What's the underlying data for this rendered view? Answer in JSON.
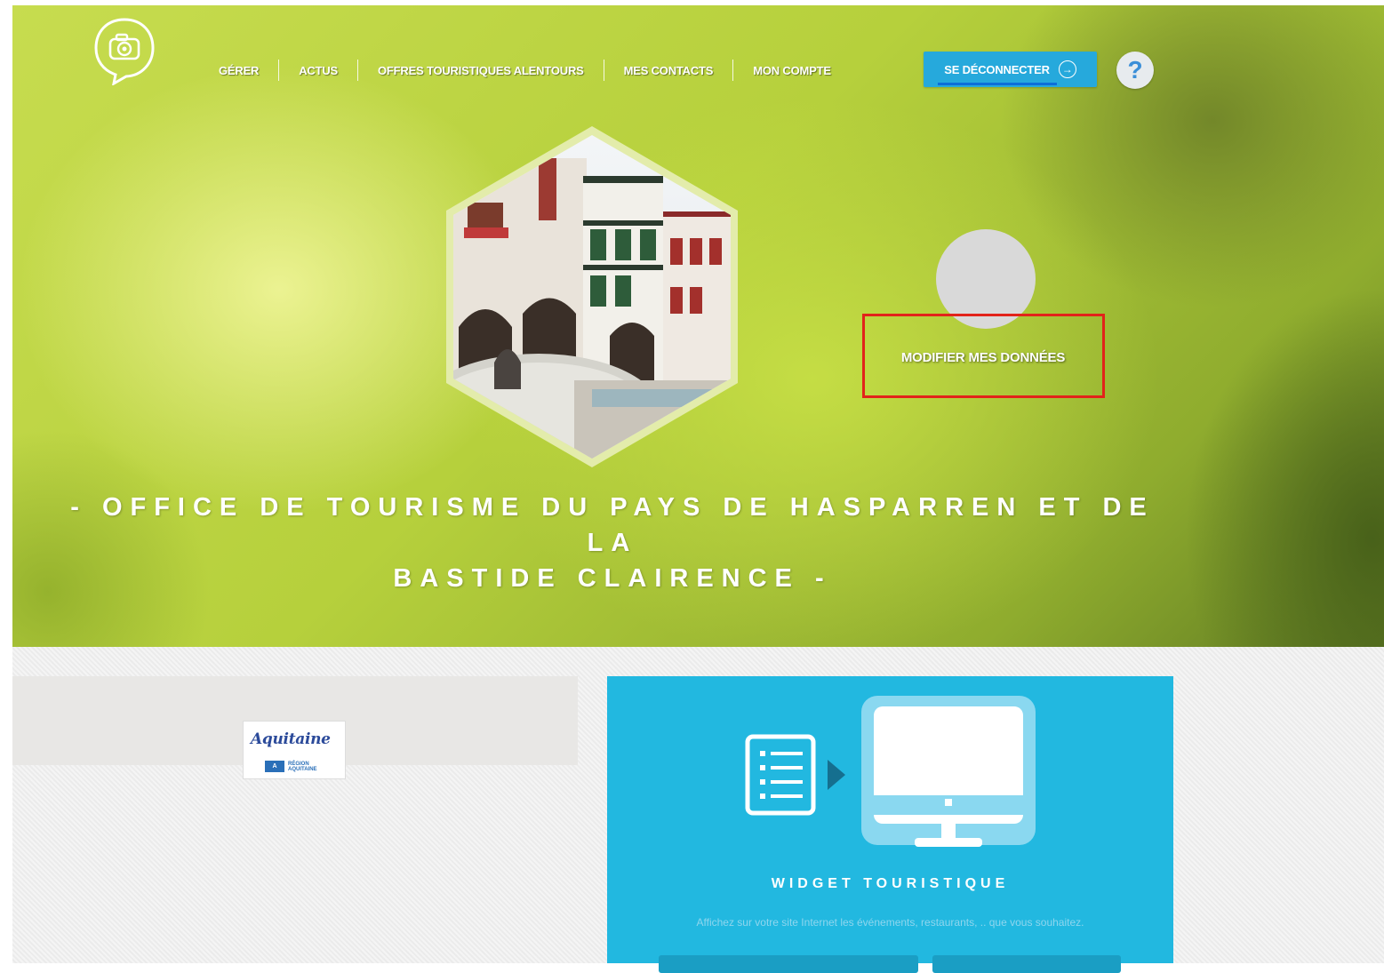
{
  "nav": {
    "items": [
      {
        "label": "GÉRER"
      },
      {
        "label": "ACTUS"
      },
      {
        "label": "OFFRES TOURISTIQUES ALENTOURS"
      },
      {
        "label": "MES CONTACTS"
      },
      {
        "label": "MON COMPTE"
      }
    ],
    "logout_label": "SE DÉCONNECTER",
    "help_label": "?"
  },
  "hero": {
    "edit_link": "MODIFIER MES DONNÉES",
    "title_line1": "- OFFICE DE TOURISME DU PAYS DE HASPARREN ET DE LA",
    "title_line2": "BASTIDE CLAIRENCE -"
  },
  "partners": {
    "logo_brand": "Aquitaine",
    "logo_sub_line1": "RÉGION",
    "logo_sub_line2": "AQUITAINE"
  },
  "widget": {
    "title": "WIDGET TOURISTIQUE",
    "description": "Affichez sur votre site Internet les événements, restaurants, .. que vous souhaitez."
  },
  "colors": {
    "accent_blue": "#26a9dc",
    "widget_blue": "#22b8e0",
    "highlight_red": "#e2231a"
  },
  "icons": [
    "camera-chat-logo-icon",
    "arrow-right-circle-icon",
    "question-icon",
    "document-list-icon",
    "play-arrow-icon",
    "monitor-icon"
  ]
}
